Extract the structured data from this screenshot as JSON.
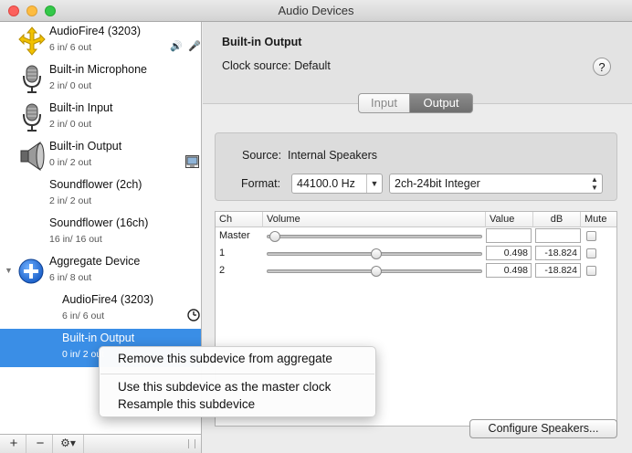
{
  "window": {
    "title": "Audio Devices"
  },
  "devices": [
    {
      "name": "AudioFire4 (3203)",
      "io": "6 in/ 6 out",
      "icon": "firewire-icon",
      "badges": [
        "🔊",
        "🎤"
      ]
    },
    {
      "name": "Built-in Microphone",
      "io": "2 in/ 0 out",
      "icon": "microphone-icon"
    },
    {
      "name": "Built-in Input",
      "io": "2 in/ 0 out",
      "icon": "microphone-icon"
    },
    {
      "name": "Built-in Output",
      "io": "0 in/ 2 out",
      "icon": "speaker-icon",
      "badges": [
        "finder-icon"
      ]
    },
    {
      "name": "Soundflower (2ch)",
      "io": "2 in/ 2 out"
    },
    {
      "name": "Soundflower (16ch)",
      "io": "16 in/ 16 out"
    },
    {
      "name": "Aggregate Device",
      "io": "6 in/ 8 out",
      "icon": "aggregate-plus-icon"
    },
    {
      "name": "AudioFire4 (3203)",
      "io": "6 in/ 6 out",
      "badges": [
        "clock-icon"
      ]
    },
    {
      "name": "Built-in Output",
      "io": "0 in/ 2 out",
      "selected": true
    }
  ],
  "header": {
    "device_name": "Built-in Output",
    "clock_source": "Clock source:  Default",
    "help": "?"
  },
  "tabs": {
    "input": "Input",
    "output": "Output",
    "active": "Output"
  },
  "source": {
    "label": "Source:",
    "value": "Internal Speakers"
  },
  "format": {
    "label": "Format:",
    "rate": "44100.0 Hz",
    "type": "2ch-24bit Integer"
  },
  "table": {
    "headers": {
      "ch": "Ch",
      "volume": "Volume",
      "value": "Value",
      "db": "dB",
      "mute": "Mute"
    },
    "rows": [
      {
        "ch": "Master",
        "value": "",
        "db": "",
        "volume": 0.0,
        "muted": false
      },
      {
        "ch": "1",
        "value": "0.498",
        "db": "-18.824",
        "volume": 0.498,
        "muted": false
      },
      {
        "ch": "2",
        "value": "0.498",
        "db": "-18.824",
        "volume": 0.498,
        "muted": false
      }
    ]
  },
  "configure_button": "Configure Speakers...",
  "context_menu": {
    "items": [
      "Remove this subdevice from aggregate",
      "Use this subdevice as the master clock",
      "Resample this subdevice"
    ]
  },
  "sidebar_bottom": {
    "add": "+",
    "remove": "−",
    "gear": "⚙▾"
  },
  "colors": {
    "selection": "#3a8ee6",
    "output_tab": "#7a7a7a"
  }
}
